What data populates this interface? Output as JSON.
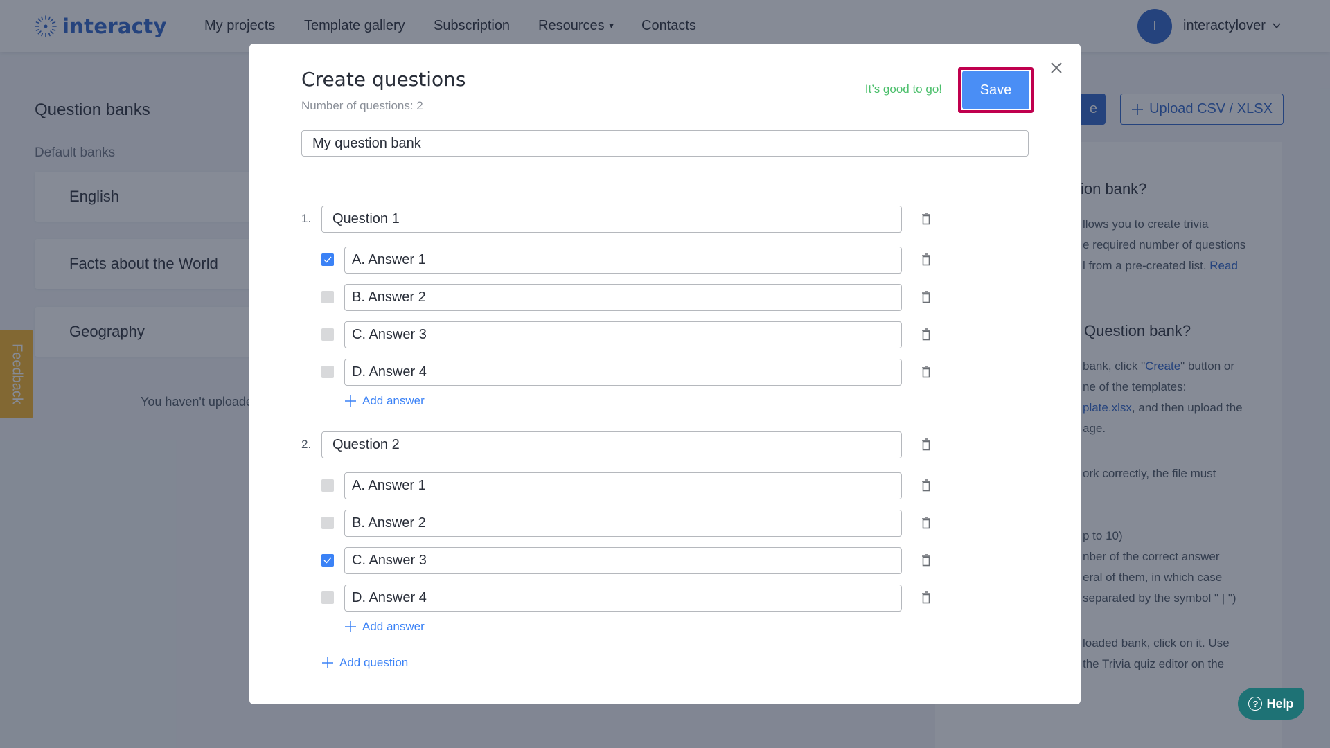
{
  "nav": {
    "logo_text": "interacty",
    "items": [
      {
        "label": "My projects"
      },
      {
        "label": "Template gallery"
      },
      {
        "label": "Subscription"
      },
      {
        "label": "Resources",
        "has_dropdown": true
      },
      {
        "label": "Contacts"
      }
    ],
    "user": {
      "avatar_initial": "I",
      "name": "interactylover"
    }
  },
  "background": {
    "title": "Question banks",
    "subtitle": "Default banks",
    "banks": [
      {
        "label": "English"
      },
      {
        "label": "Facts about the World"
      },
      {
        "label": "Geography"
      }
    ],
    "empty_text": "You haven't uploaded",
    "create_button_fragment": "e",
    "upload_button": "Upload CSV / XLSX",
    "help": {
      "heading1": "ion bank?",
      "p1": [
        "llows you to create trivia",
        "e required number of questions",
        "l from a pre-created list. "
      ],
      "p1_link": "Read",
      "heading2": "Question bank?",
      "p2_line1_pre": "bank, click \"",
      "p2_line1_link": "Create",
      "p2_line1_post": "\" button or",
      "p2_line2": "ne of the templates:",
      "p2_line3_link": "plate.xlsx",
      "p2_line3_post": ", and then upload the",
      "p2_line4": "age.",
      "p3": "ork correctly, the file must",
      "p4": [
        "p to 10)",
        "nber of the correct answer",
        "eral of them, in which case",
        "separated by the symbol \" | \")"
      ],
      "p5": [
        "loaded bank, click on it. Use",
        "the Trivia quiz editor on the"
      ]
    },
    "feedback_label": "Feedback",
    "help_button": "Help"
  },
  "modal": {
    "title": "Create questions",
    "count_text": "Number of questions: 2",
    "status_text": "It’s good to go!",
    "save_label": "Save",
    "bank_name": "My question bank",
    "questions": [
      {
        "number": "1.",
        "text": "Question 1",
        "answers": [
          {
            "text": "A. Answer 1",
            "correct": true
          },
          {
            "text": "B. Answer 2",
            "correct": false
          },
          {
            "text": "C. Answer 3",
            "correct": false
          },
          {
            "text": "D. Answer 4",
            "correct": false
          }
        ],
        "add_answer_label": "Add answer"
      },
      {
        "number": "2.",
        "text": "Question 2",
        "answers": [
          {
            "text": "A. Answer 1",
            "correct": false
          },
          {
            "text": "B. Answer 2",
            "correct": false
          },
          {
            "text": "C. Answer 3",
            "correct": true
          },
          {
            "text": "D. Answer 4",
            "correct": false
          }
        ],
        "add_answer_label": "Add answer"
      }
    ],
    "add_question_label": "Add question"
  },
  "colors": {
    "brand": "#2d63c8",
    "save_button": "#4a8ef5",
    "save_highlight": "#c0004e",
    "status_ok": "#4bbf6b",
    "feedback": "#f7b329",
    "help": "#1e7275"
  }
}
